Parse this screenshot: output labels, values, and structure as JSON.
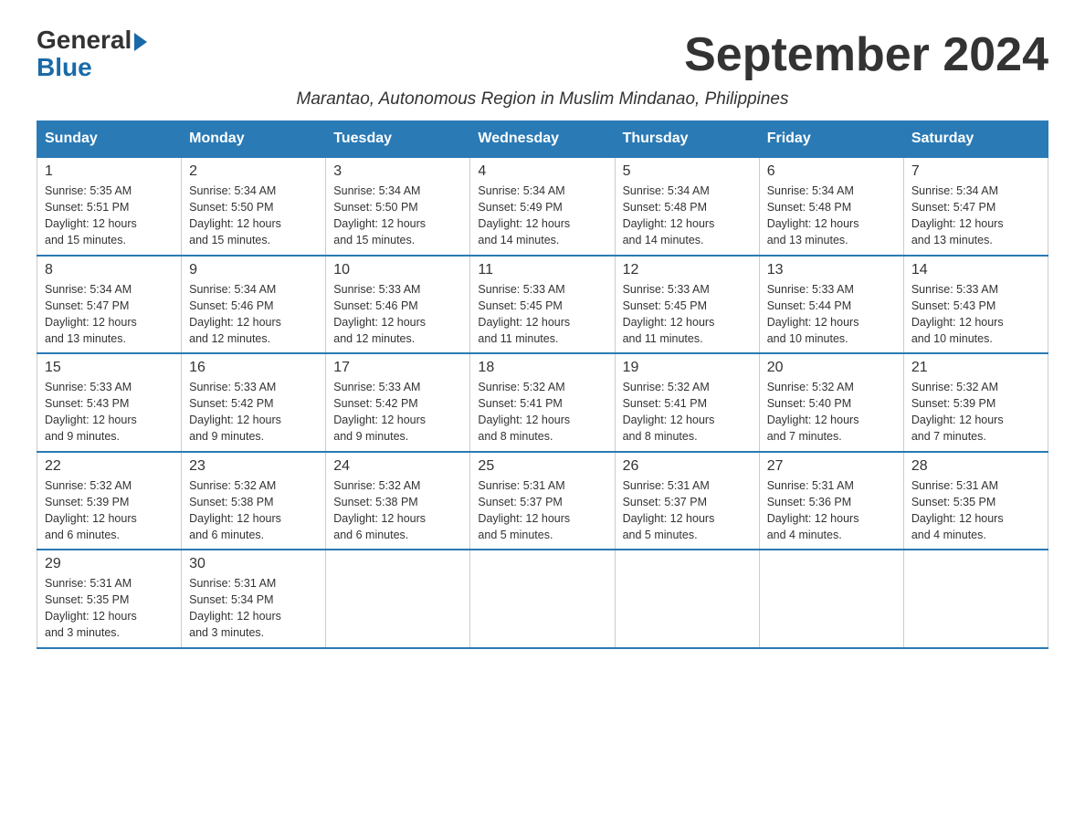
{
  "header": {
    "logo_line1": "General",
    "logo_line2": "Blue",
    "month_title": "September 2024",
    "subtitle": "Marantao, Autonomous Region in Muslim Mindanao, Philippines"
  },
  "calendar": {
    "days_of_week": [
      "Sunday",
      "Monday",
      "Tuesday",
      "Wednesday",
      "Thursday",
      "Friday",
      "Saturday"
    ],
    "weeks": [
      [
        {
          "day": "1",
          "sunrise": "5:35 AM",
          "sunset": "5:51 PM",
          "daylight": "12 hours and 15 minutes."
        },
        {
          "day": "2",
          "sunrise": "5:34 AM",
          "sunset": "5:50 PM",
          "daylight": "12 hours and 15 minutes."
        },
        {
          "day": "3",
          "sunrise": "5:34 AM",
          "sunset": "5:50 PM",
          "daylight": "12 hours and 15 minutes."
        },
        {
          "day": "4",
          "sunrise": "5:34 AM",
          "sunset": "5:49 PM",
          "daylight": "12 hours and 14 minutes."
        },
        {
          "day": "5",
          "sunrise": "5:34 AM",
          "sunset": "5:48 PM",
          "daylight": "12 hours and 14 minutes."
        },
        {
          "day": "6",
          "sunrise": "5:34 AM",
          "sunset": "5:48 PM",
          "daylight": "12 hours and 13 minutes."
        },
        {
          "day": "7",
          "sunrise": "5:34 AM",
          "sunset": "5:47 PM",
          "daylight": "12 hours and 13 minutes."
        }
      ],
      [
        {
          "day": "8",
          "sunrise": "5:34 AM",
          "sunset": "5:47 PM",
          "daylight": "12 hours and 13 minutes."
        },
        {
          "day": "9",
          "sunrise": "5:34 AM",
          "sunset": "5:46 PM",
          "daylight": "12 hours and 12 minutes."
        },
        {
          "day": "10",
          "sunrise": "5:33 AM",
          "sunset": "5:46 PM",
          "daylight": "12 hours and 12 minutes."
        },
        {
          "day": "11",
          "sunrise": "5:33 AM",
          "sunset": "5:45 PM",
          "daylight": "12 hours and 11 minutes."
        },
        {
          "day": "12",
          "sunrise": "5:33 AM",
          "sunset": "5:45 PM",
          "daylight": "12 hours and 11 minutes."
        },
        {
          "day": "13",
          "sunrise": "5:33 AM",
          "sunset": "5:44 PM",
          "daylight": "12 hours and 10 minutes."
        },
        {
          "day": "14",
          "sunrise": "5:33 AM",
          "sunset": "5:43 PM",
          "daylight": "12 hours and 10 minutes."
        }
      ],
      [
        {
          "day": "15",
          "sunrise": "5:33 AM",
          "sunset": "5:43 PM",
          "daylight": "12 hours and 9 minutes."
        },
        {
          "day": "16",
          "sunrise": "5:33 AM",
          "sunset": "5:42 PM",
          "daylight": "12 hours and 9 minutes."
        },
        {
          "day": "17",
          "sunrise": "5:33 AM",
          "sunset": "5:42 PM",
          "daylight": "12 hours and 9 minutes."
        },
        {
          "day": "18",
          "sunrise": "5:32 AM",
          "sunset": "5:41 PM",
          "daylight": "12 hours and 8 minutes."
        },
        {
          "day": "19",
          "sunrise": "5:32 AM",
          "sunset": "5:41 PM",
          "daylight": "12 hours and 8 minutes."
        },
        {
          "day": "20",
          "sunrise": "5:32 AM",
          "sunset": "5:40 PM",
          "daylight": "12 hours and 7 minutes."
        },
        {
          "day": "21",
          "sunrise": "5:32 AM",
          "sunset": "5:39 PM",
          "daylight": "12 hours and 7 minutes."
        }
      ],
      [
        {
          "day": "22",
          "sunrise": "5:32 AM",
          "sunset": "5:39 PM",
          "daylight": "12 hours and 6 minutes."
        },
        {
          "day": "23",
          "sunrise": "5:32 AM",
          "sunset": "5:38 PM",
          "daylight": "12 hours and 6 minutes."
        },
        {
          "day": "24",
          "sunrise": "5:32 AM",
          "sunset": "5:38 PM",
          "daylight": "12 hours and 6 minutes."
        },
        {
          "day": "25",
          "sunrise": "5:31 AM",
          "sunset": "5:37 PM",
          "daylight": "12 hours and 5 minutes."
        },
        {
          "day": "26",
          "sunrise": "5:31 AM",
          "sunset": "5:37 PM",
          "daylight": "12 hours and 5 minutes."
        },
        {
          "day": "27",
          "sunrise": "5:31 AM",
          "sunset": "5:36 PM",
          "daylight": "12 hours and 4 minutes."
        },
        {
          "day": "28",
          "sunrise": "5:31 AM",
          "sunset": "5:35 PM",
          "daylight": "12 hours and 4 minutes."
        }
      ],
      [
        {
          "day": "29",
          "sunrise": "5:31 AM",
          "sunset": "5:35 PM",
          "daylight": "12 hours and 3 minutes."
        },
        {
          "day": "30",
          "sunrise": "5:31 AM",
          "sunset": "5:34 PM",
          "daylight": "12 hours and 3 minutes."
        },
        null,
        null,
        null,
        null,
        null
      ]
    ]
  }
}
